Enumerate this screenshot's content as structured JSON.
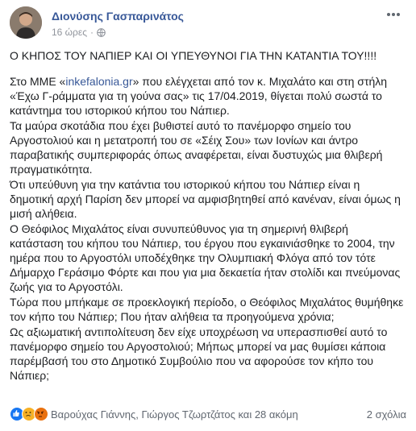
{
  "author": {
    "name": "Διονύσης Γασπαρινάτος",
    "time": "16 ώρες",
    "privacy_icon": "globe-icon"
  },
  "post": {
    "headline": "Ο ΚΗΠΟΣ ΤΟΥ ΝΑΠΙΕΡ ΚΑΙ ΟΙ ΥΠΕΥΘΥΝΟΙ ΓΙΑ ΤΗΝ ΚΑΤΑΝΤΙΑ ΤΟΥ!!!!",
    "p1_before": "Στο ΜΜΕ «",
    "p1_link": "inkefalonia.gr",
    "p1_after": "» που ελέγχεται από τον κ. Μιχαλάτο και στη στήλη «Έχω Γ-ράμματα για τη γούνα σας» τις 17/04.2019, θίγεται πολύ σωστά το κατάντημα του ιστορικού κήπου του Νάπιερ.",
    "p2": "Τα μαύρα σκοτάδια που έχει βυθιστεί αυτό το πανέμορφο σημείο του Αργοστολιού και η μετατροπή του σε «Σέιχ Σου» των Ιονίων και άντρο παραβατικής συμπεριφοράς όπως αναφέρεται, είναι δυστυχώς μια θλιβερή πραγματικότητα.",
    "p3": "Ότι υπεύθυνη για την κατάντια του ιστορικού κήπου του Νάπιερ είναι η δημοτική αρχή Παρίση δεν μπορεί να αμφισβητηθεί από κανέναν, είναι όμως η μισή αλήθεια.",
    "p4": "Ο Θεόφιλος Μιχαλάτος είναι συνυπεύθυνος για τη σημερινή θλιβερή κατάσταση του κήπου του Νάπιερ, του έργου που εγκαινιάσθηκε το 2004, την ημέρα που το Αργοστόλι υποδέχθηκε την Ολυμπιακή Φλόγα από τον τότε Δήμαρχο Γεράσιμο Φόρτε και που για μια δεκαετία ήταν στολίδι και πνεύμονας ζωής για το Αργοστόλι.",
    "p5": "Τώρα που μπήκαμε σε προεκλογική περίοδο, ο Θεόφιλος Μιχαλάτος θυμήθηκε τον κήπο του Νάπιερ; Που ήταν αλήθεια τα προηγούμενα χρόνια;",
    "p6": "Ως αξιωματική αντιπολίτευση δεν είχε υποχρέωση να υπερασπισθεί αυτό το πανέμορφο σημείο του Αργοστολιού; Μήπως μπορεί να μας θυμίσει κάποια παρέμβασή του στο Δημοτικό Συμβούλιο που να αφορούσε τον κήπο του Νάπιερ;"
  },
  "footer": {
    "reactors": "Βαρούχας Γιάννης, Γιώργος Τζωρτζάτος και 28 ακόμη",
    "comments": "2 σχόλια",
    "reaction_icons": [
      "like-icon",
      "sad-icon",
      "angry-icon"
    ]
  },
  "colors": {
    "link": "#385898",
    "text": "#1c1e21",
    "meta": "#90949c"
  }
}
